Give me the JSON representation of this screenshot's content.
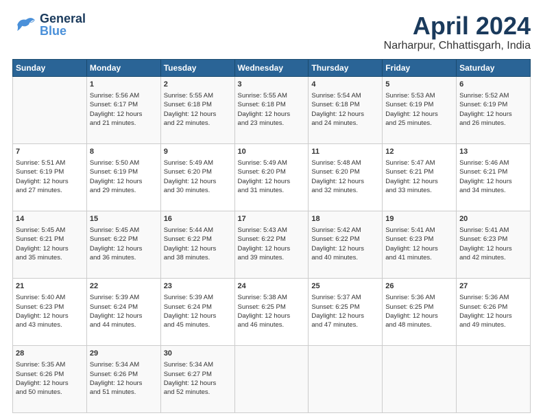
{
  "header": {
    "logo_general": "General",
    "logo_blue": "Blue",
    "main_title": "April 2024",
    "subtitle": "Narharpur, Chhattisgarh, India"
  },
  "calendar": {
    "days_of_week": [
      "Sunday",
      "Monday",
      "Tuesday",
      "Wednesday",
      "Thursday",
      "Friday",
      "Saturday"
    ],
    "weeks": [
      [
        {
          "num": "",
          "lines": []
        },
        {
          "num": "1",
          "lines": [
            "Sunrise: 5:56 AM",
            "Sunset: 6:17 PM",
            "Daylight: 12 hours",
            "and 21 minutes."
          ]
        },
        {
          "num": "2",
          "lines": [
            "Sunrise: 5:55 AM",
            "Sunset: 6:18 PM",
            "Daylight: 12 hours",
            "and 22 minutes."
          ]
        },
        {
          "num": "3",
          "lines": [
            "Sunrise: 5:55 AM",
            "Sunset: 6:18 PM",
            "Daylight: 12 hours",
            "and 23 minutes."
          ]
        },
        {
          "num": "4",
          "lines": [
            "Sunrise: 5:54 AM",
            "Sunset: 6:18 PM",
            "Daylight: 12 hours",
            "and 24 minutes."
          ]
        },
        {
          "num": "5",
          "lines": [
            "Sunrise: 5:53 AM",
            "Sunset: 6:19 PM",
            "Daylight: 12 hours",
            "and 25 minutes."
          ]
        },
        {
          "num": "6",
          "lines": [
            "Sunrise: 5:52 AM",
            "Sunset: 6:19 PM",
            "Daylight: 12 hours",
            "and 26 minutes."
          ]
        }
      ],
      [
        {
          "num": "7",
          "lines": [
            "Sunrise: 5:51 AM",
            "Sunset: 6:19 PM",
            "Daylight: 12 hours",
            "and 27 minutes."
          ]
        },
        {
          "num": "8",
          "lines": [
            "Sunrise: 5:50 AM",
            "Sunset: 6:19 PM",
            "Daylight: 12 hours",
            "and 29 minutes."
          ]
        },
        {
          "num": "9",
          "lines": [
            "Sunrise: 5:49 AM",
            "Sunset: 6:20 PM",
            "Daylight: 12 hours",
            "and 30 minutes."
          ]
        },
        {
          "num": "10",
          "lines": [
            "Sunrise: 5:49 AM",
            "Sunset: 6:20 PM",
            "Daylight: 12 hours",
            "and 31 minutes."
          ]
        },
        {
          "num": "11",
          "lines": [
            "Sunrise: 5:48 AM",
            "Sunset: 6:20 PM",
            "Daylight: 12 hours",
            "and 32 minutes."
          ]
        },
        {
          "num": "12",
          "lines": [
            "Sunrise: 5:47 AM",
            "Sunset: 6:21 PM",
            "Daylight: 12 hours",
            "and 33 minutes."
          ]
        },
        {
          "num": "13",
          "lines": [
            "Sunrise: 5:46 AM",
            "Sunset: 6:21 PM",
            "Daylight: 12 hours",
            "and 34 minutes."
          ]
        }
      ],
      [
        {
          "num": "14",
          "lines": [
            "Sunrise: 5:45 AM",
            "Sunset: 6:21 PM",
            "Daylight: 12 hours",
            "and 35 minutes."
          ]
        },
        {
          "num": "15",
          "lines": [
            "Sunrise: 5:45 AM",
            "Sunset: 6:22 PM",
            "Daylight: 12 hours",
            "and 36 minutes."
          ]
        },
        {
          "num": "16",
          "lines": [
            "Sunrise: 5:44 AM",
            "Sunset: 6:22 PM",
            "Daylight: 12 hours",
            "and 38 minutes."
          ]
        },
        {
          "num": "17",
          "lines": [
            "Sunrise: 5:43 AM",
            "Sunset: 6:22 PM",
            "Daylight: 12 hours",
            "and 39 minutes."
          ]
        },
        {
          "num": "18",
          "lines": [
            "Sunrise: 5:42 AM",
            "Sunset: 6:22 PM",
            "Daylight: 12 hours",
            "and 40 minutes."
          ]
        },
        {
          "num": "19",
          "lines": [
            "Sunrise: 5:41 AM",
            "Sunset: 6:23 PM",
            "Daylight: 12 hours",
            "and 41 minutes."
          ]
        },
        {
          "num": "20",
          "lines": [
            "Sunrise: 5:41 AM",
            "Sunset: 6:23 PM",
            "Daylight: 12 hours",
            "and 42 minutes."
          ]
        }
      ],
      [
        {
          "num": "21",
          "lines": [
            "Sunrise: 5:40 AM",
            "Sunset: 6:23 PM",
            "Daylight: 12 hours",
            "and 43 minutes."
          ]
        },
        {
          "num": "22",
          "lines": [
            "Sunrise: 5:39 AM",
            "Sunset: 6:24 PM",
            "Daylight: 12 hours",
            "and 44 minutes."
          ]
        },
        {
          "num": "23",
          "lines": [
            "Sunrise: 5:39 AM",
            "Sunset: 6:24 PM",
            "Daylight: 12 hours",
            "and 45 minutes."
          ]
        },
        {
          "num": "24",
          "lines": [
            "Sunrise: 5:38 AM",
            "Sunset: 6:25 PM",
            "Daylight: 12 hours",
            "and 46 minutes."
          ]
        },
        {
          "num": "25",
          "lines": [
            "Sunrise: 5:37 AM",
            "Sunset: 6:25 PM",
            "Daylight: 12 hours",
            "and 47 minutes."
          ]
        },
        {
          "num": "26",
          "lines": [
            "Sunrise: 5:36 AM",
            "Sunset: 6:25 PM",
            "Daylight: 12 hours",
            "and 48 minutes."
          ]
        },
        {
          "num": "27",
          "lines": [
            "Sunrise: 5:36 AM",
            "Sunset: 6:26 PM",
            "Daylight: 12 hours",
            "and 49 minutes."
          ]
        }
      ],
      [
        {
          "num": "28",
          "lines": [
            "Sunrise: 5:35 AM",
            "Sunset: 6:26 PM",
            "Daylight: 12 hours",
            "and 50 minutes."
          ]
        },
        {
          "num": "29",
          "lines": [
            "Sunrise: 5:34 AM",
            "Sunset: 6:26 PM",
            "Daylight: 12 hours",
            "and 51 minutes."
          ]
        },
        {
          "num": "30",
          "lines": [
            "Sunrise: 5:34 AM",
            "Sunset: 6:27 PM",
            "Daylight: 12 hours",
            "and 52 minutes."
          ]
        },
        {
          "num": "",
          "lines": []
        },
        {
          "num": "",
          "lines": []
        },
        {
          "num": "",
          "lines": []
        },
        {
          "num": "",
          "lines": []
        }
      ]
    ]
  }
}
